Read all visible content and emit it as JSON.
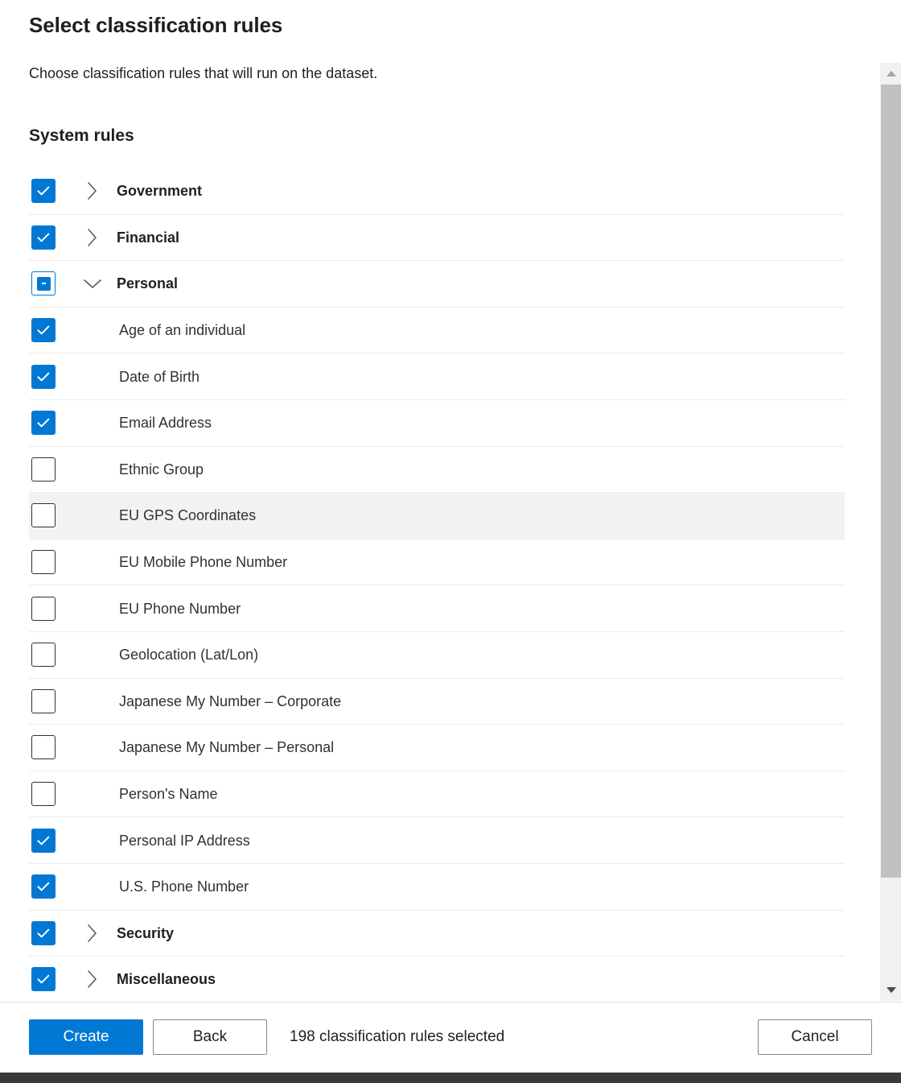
{
  "header": {
    "title": "Select classification rules",
    "subtitle": "Choose classification rules that will run on the dataset.",
    "section_title": "System rules"
  },
  "rules": [
    {
      "label": "Government",
      "level": "group",
      "state": "checked",
      "expanded": false,
      "hovered": false
    },
    {
      "label": "Financial",
      "level": "group",
      "state": "checked",
      "expanded": false,
      "hovered": false
    },
    {
      "label": "Personal",
      "level": "group",
      "state": "indeterminate",
      "expanded": true,
      "hovered": false
    },
    {
      "label": "Age of an individual",
      "level": "child",
      "state": "checked",
      "expanded": null,
      "hovered": false
    },
    {
      "label": "Date of Birth",
      "level": "child",
      "state": "checked",
      "expanded": null,
      "hovered": false
    },
    {
      "label": "Email Address",
      "level": "child",
      "state": "checked",
      "expanded": null,
      "hovered": false
    },
    {
      "label": "Ethnic Group",
      "level": "child",
      "state": "unchecked",
      "expanded": null,
      "hovered": false
    },
    {
      "label": "EU GPS Coordinates",
      "level": "child",
      "state": "unchecked",
      "expanded": null,
      "hovered": true
    },
    {
      "label": "EU Mobile Phone Number",
      "level": "child",
      "state": "unchecked",
      "expanded": null,
      "hovered": false
    },
    {
      "label": "EU Phone Number",
      "level": "child",
      "state": "unchecked",
      "expanded": null,
      "hovered": false
    },
    {
      "label": "Geolocation (Lat/Lon)",
      "level": "child",
      "state": "unchecked",
      "expanded": null,
      "hovered": false
    },
    {
      "label": "Japanese My Number – Corporate",
      "level": "child",
      "state": "unchecked",
      "expanded": null,
      "hovered": false
    },
    {
      "label": "Japanese My Number – Personal",
      "level": "child",
      "state": "unchecked",
      "expanded": null,
      "hovered": false
    },
    {
      "label": "Person's Name",
      "level": "child",
      "state": "unchecked",
      "expanded": null,
      "hovered": false
    },
    {
      "label": "Personal IP Address",
      "level": "child",
      "state": "checked",
      "expanded": null,
      "hovered": false
    },
    {
      "label": "U.S. Phone Number",
      "level": "child",
      "state": "checked",
      "expanded": null,
      "hovered": false
    },
    {
      "label": "Security",
      "level": "group",
      "state": "checked",
      "expanded": false,
      "hovered": false
    },
    {
      "label": "Miscellaneous",
      "level": "group",
      "state": "checked",
      "expanded": false,
      "hovered": false
    }
  ],
  "footer": {
    "create_label": "Create",
    "back_label": "Back",
    "selected_text": "198 classification rules selected",
    "cancel_label": "Cancel"
  },
  "scrollbar": {
    "up_arrow_icon": "caret-up-icon",
    "down_arrow_icon": "caret-down-icon"
  },
  "colors": {
    "accent": "#0078d4",
    "row_hover": "#f3f2f1",
    "row_divider": "#edebe9",
    "text": "#201f1e",
    "scrollbar_thumb": "#c1c1c1",
    "bottom_bar": "#3b3a39"
  }
}
